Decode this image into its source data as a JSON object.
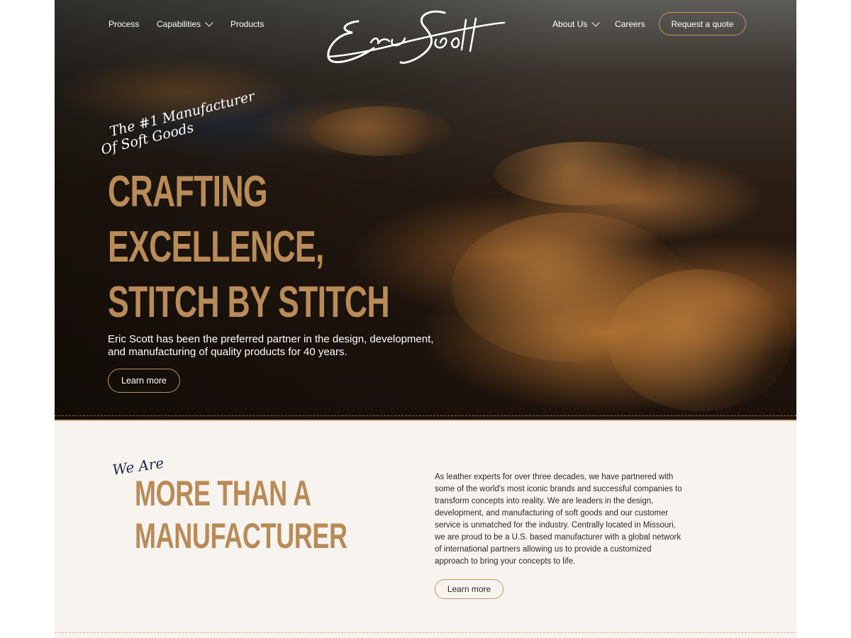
{
  "nav": {
    "process": "Process",
    "capabilities": "Capabilities",
    "products": "Products",
    "about": "About Us",
    "careers": "Careers",
    "quote": "Request a quote"
  },
  "logo": {
    "text": "Eric Scott"
  },
  "hero": {
    "script_line1": "The #1 Manufacturer",
    "script_line2": "Of Soft Goods",
    "title_line1": "CRAFTING",
    "title_line2": "EXCELLENCE,",
    "title_line3": "STITCH BY STITCH",
    "subtitle": "Eric Scott has been the preferred partner in the design, development, and manufacturing of quality products for 40 years.",
    "button": "Learn more"
  },
  "about": {
    "script": "We Are",
    "title_line1": "MORE THAN A",
    "title_line2": "MANUFACTURER",
    "body": "As leather experts for over three decades, we have partnered with some of the world's most iconic brands and successful companies to transform concepts into reality. We are leaders in the design, development, and manufacturing of soft goods and our customer service is unmatched for the industry. Centrally located in Missouri, we are proud to be a U.S. based manufacturer with a global network of international partners allowing us to provide a customized approach to bring your concepts to life.",
    "button": "Learn more"
  },
  "colors": {
    "accent": "#b88b57",
    "button_border": "#c4965f",
    "section_bg": "#f7f3ef",
    "script_navy": "#1f2b4a"
  }
}
